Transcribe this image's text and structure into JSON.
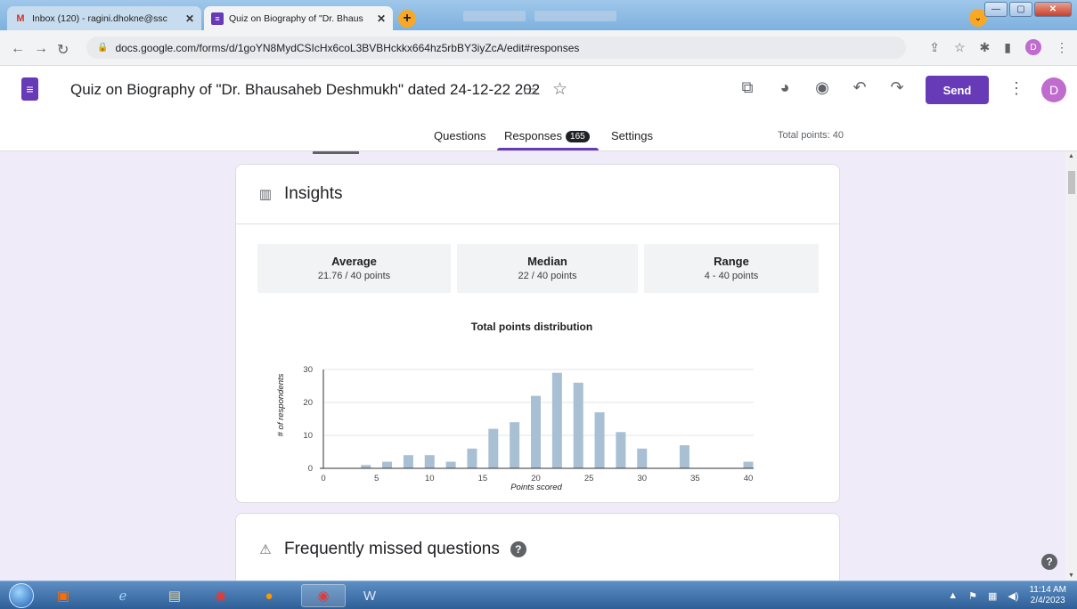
{
  "browser": {
    "tabs": [
      {
        "title": "Inbox (120) - ragini.dhokne@ssc",
        "favicon": "gmail-icon",
        "active": false
      },
      {
        "title": "Quiz on Biography of \"Dr. Bhaus",
        "favicon": "google-forms-icon",
        "active": true
      }
    ],
    "new_tab": "+",
    "url": "docs.google.com/forms/d/1goYN8MydCSIcHx6coL3BVBHckkx664hz5rbBY3iyZcA/edit#responses",
    "profile_initial": "D"
  },
  "form": {
    "title": "Quiz  on  Biography of \"Dr. Bhausaheb Deshmukh\"  dated 24-12-22 202",
    "send_label": "Send",
    "avatar_initial": "D",
    "tabs": {
      "questions": "Questions",
      "responses": "Responses",
      "responses_count": "165",
      "settings": "Settings"
    },
    "total_points": "Total points: 40"
  },
  "insights": {
    "title": "Insights",
    "stats": [
      {
        "label": "Average",
        "value": "21.76 / 40 points"
      },
      {
        "label": "Median",
        "value": "22 / 40 points"
      },
      {
        "label": "Range",
        "value": "4 - 40 points"
      }
    ]
  },
  "chart_data": {
    "type": "bar",
    "title": "Total points distribution",
    "xlabel": "Points scored",
    "ylabel": "# of respondents",
    "x": [
      4,
      6,
      8,
      10,
      12,
      14,
      16,
      18,
      20,
      22,
      24,
      26,
      28,
      30,
      34,
      40
    ],
    "values": [
      1,
      2,
      4,
      4,
      2,
      6,
      12,
      14,
      22,
      29,
      26,
      17,
      11,
      6,
      7,
      2
    ],
    "xlim": [
      0,
      40
    ],
    "ylim": [
      0,
      30
    ],
    "xticks": [
      0,
      5,
      10,
      15,
      20,
      25,
      30,
      35,
      40
    ],
    "yticks": [
      0,
      10,
      20,
      30
    ],
    "bar_color": "#a8bfd4",
    "grid": true
  },
  "missed": {
    "title": "Frequently missed questions"
  },
  "taskbar": {
    "time": "11:14 AM",
    "date": "2/4/2023"
  },
  "colors": {
    "brand": "#673ab7",
    "background": "#f0ebf8"
  }
}
